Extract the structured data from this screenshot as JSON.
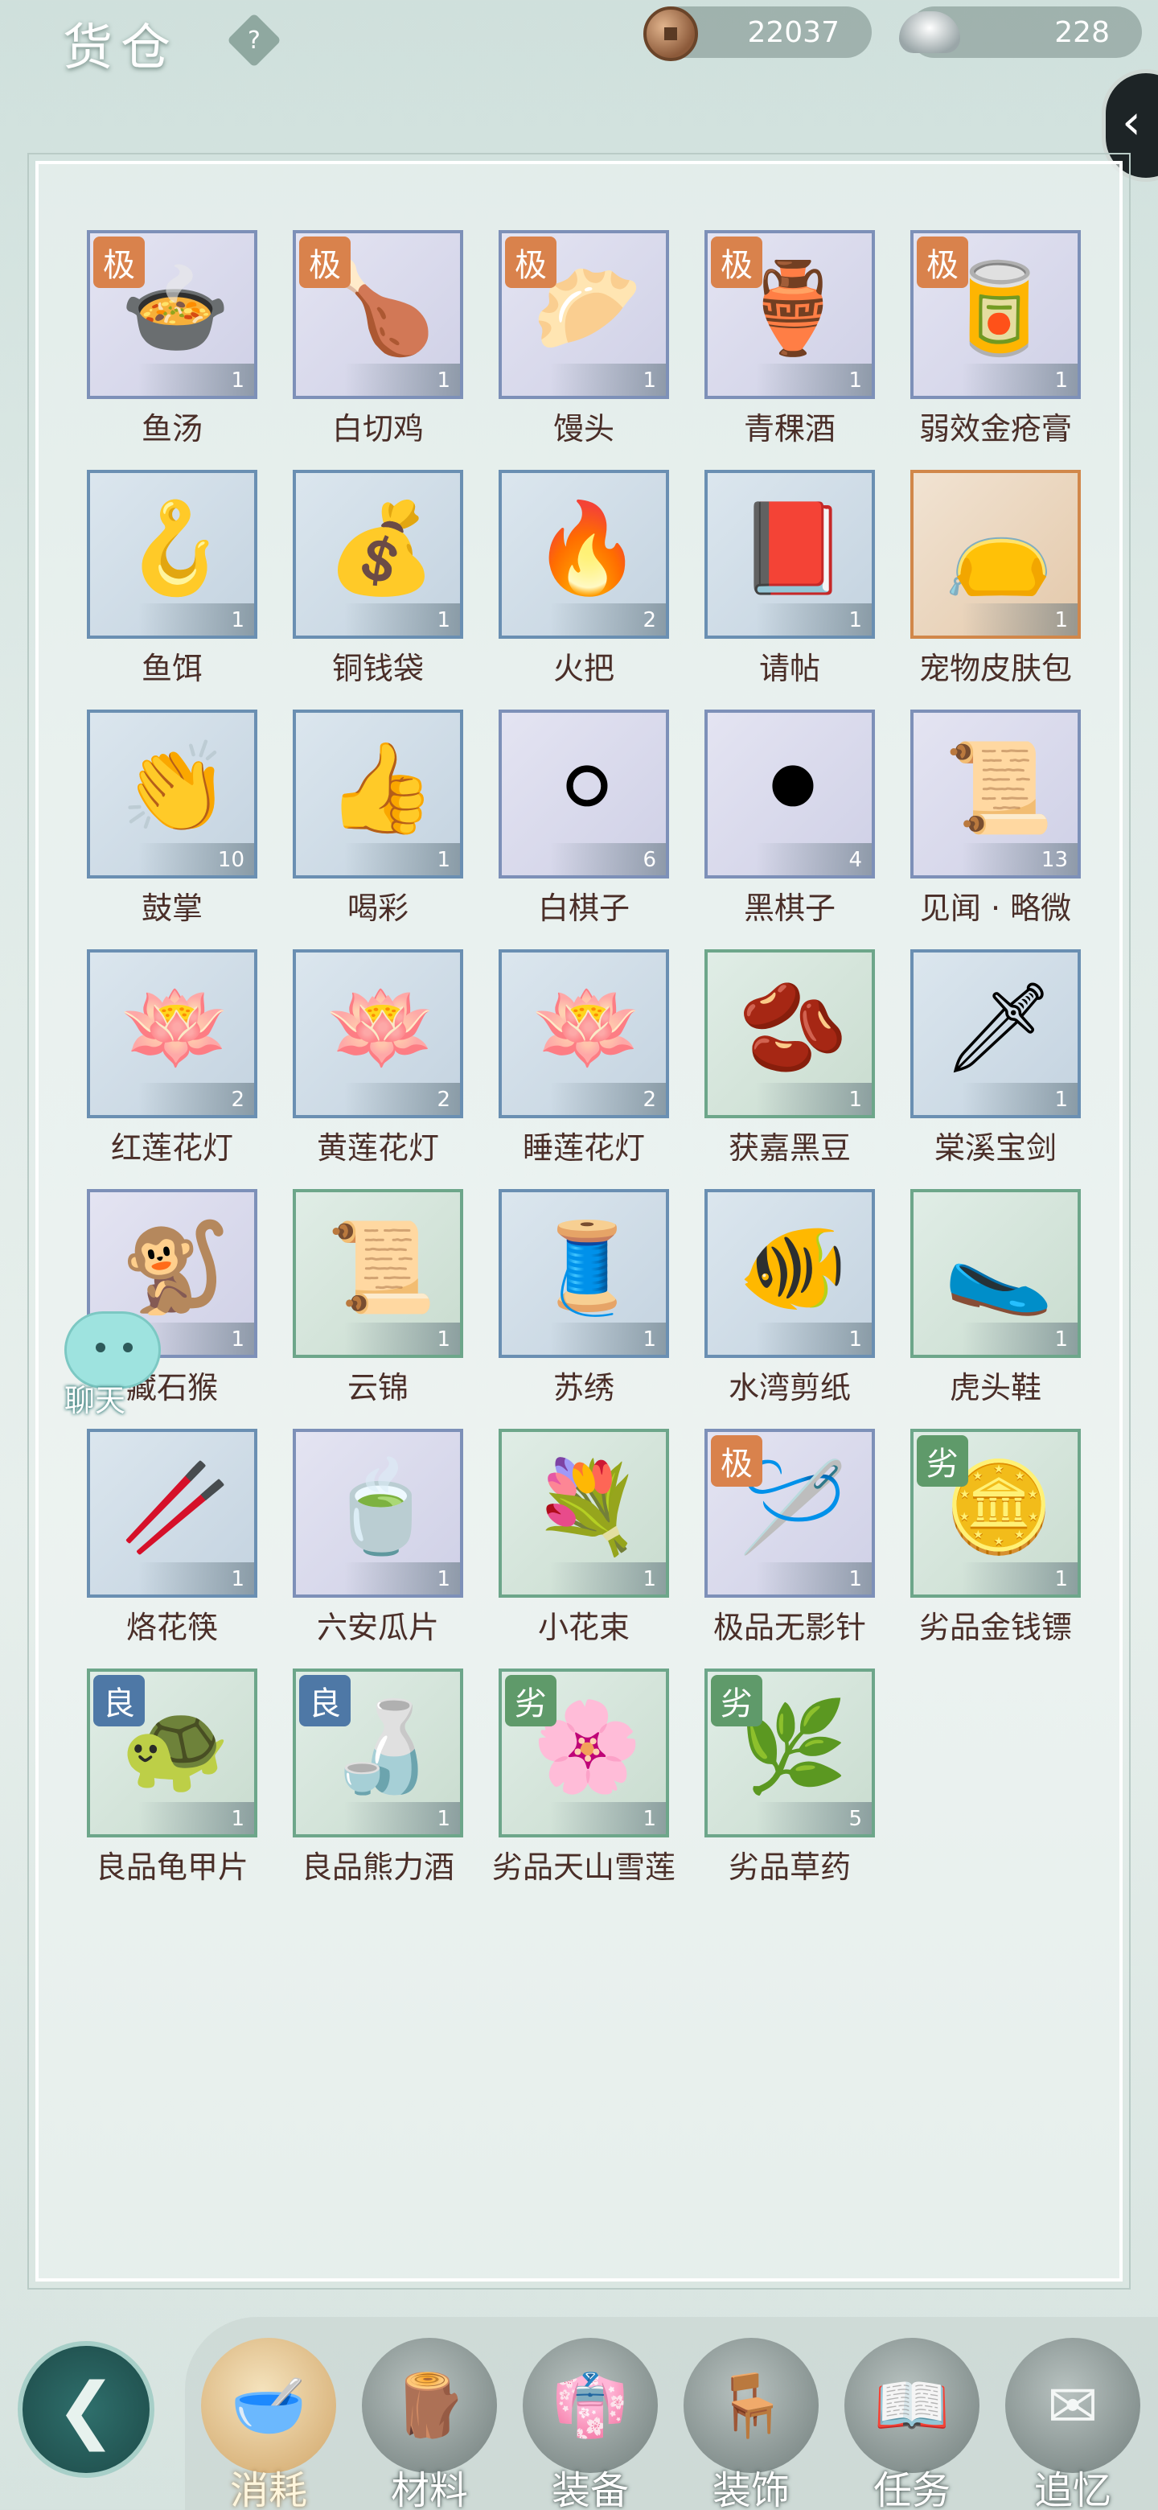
{
  "header": {
    "title": "货仓",
    "help": "?",
    "copper": "22037",
    "silver": "228"
  },
  "chat": {
    "label": "聊天"
  },
  "items": [
    {
      "name": "鱼汤",
      "count": "1",
      "badge": "极",
      "icon": "🍲",
      "frame": "purple"
    },
    {
      "name": "白切鸡",
      "count": "1",
      "badge": "极",
      "icon": "🍗",
      "frame": "purple"
    },
    {
      "name": "馒头",
      "count": "1",
      "badge": "极",
      "icon": "🥟",
      "frame": "purple"
    },
    {
      "name": "青稞酒",
      "count": "1",
      "badge": "极",
      "icon": "🏺",
      "frame": "purple"
    },
    {
      "name": "弱效金疮膏",
      "count": "1",
      "badge": "极",
      "icon": "🥫",
      "frame": "purple"
    },
    {
      "name": "鱼饵",
      "count": "1",
      "badge": "",
      "icon": "🪝",
      "frame": "blue"
    },
    {
      "name": "铜钱袋",
      "count": "1",
      "badge": "",
      "icon": "💰",
      "frame": "blue"
    },
    {
      "name": "火把",
      "count": "2",
      "badge": "",
      "icon": "🔥",
      "frame": "blue"
    },
    {
      "name": "请帖",
      "count": "1",
      "badge": "",
      "icon": "📕",
      "frame": "blue"
    },
    {
      "name": "宠物皮肤包",
      "count": "1",
      "badge": "",
      "icon": "👝",
      "frame": "orange"
    },
    {
      "name": "鼓掌",
      "count": "10",
      "badge": "",
      "icon": "👏",
      "frame": "blue"
    },
    {
      "name": "喝彩",
      "count": "1",
      "badge": "",
      "icon": "👍",
      "frame": "blue"
    },
    {
      "name": "白棋子",
      "count": "6",
      "badge": "",
      "icon": "⚪",
      "frame": "purple"
    },
    {
      "name": "黑棋子",
      "count": "4",
      "badge": "",
      "icon": "⚫",
      "frame": "purple"
    },
    {
      "name": "见闻 · 略微",
      "count": "13",
      "badge": "",
      "icon": "📜",
      "frame": "purple"
    },
    {
      "name": "红莲花灯",
      "count": "2",
      "badge": "",
      "icon": "🪷",
      "frame": "blue"
    },
    {
      "name": "黄莲花灯",
      "count": "2",
      "badge": "",
      "icon": "🪷",
      "frame": "blue"
    },
    {
      "name": "睡莲花灯",
      "count": "2",
      "badge": "",
      "icon": "🪷",
      "frame": "blue"
    },
    {
      "name": "获嘉黑豆",
      "count": "1",
      "badge": "",
      "icon": "🫘",
      "frame": "green"
    },
    {
      "name": "棠溪宝剑",
      "count": "1",
      "badge": "",
      "icon": "🗡",
      "frame": "blue"
    },
    {
      "name": "藏石猴",
      "count": "1",
      "badge": "",
      "icon": "🐒",
      "frame": "purple"
    },
    {
      "name": "云锦",
      "count": "1",
      "badge": "",
      "icon": "📜",
      "frame": "green"
    },
    {
      "name": "苏绣",
      "count": "1",
      "badge": "",
      "icon": "🧵",
      "frame": "blue"
    },
    {
      "name": "水湾剪纸",
      "count": "1",
      "badge": "",
      "icon": "🐠",
      "frame": "blue"
    },
    {
      "name": "虎头鞋",
      "count": "1",
      "badge": "",
      "icon": "🥿",
      "frame": "green"
    },
    {
      "name": "烙花筷",
      "count": "1",
      "badge": "",
      "icon": "🥢",
      "frame": "blue"
    },
    {
      "name": "六安瓜片",
      "count": "1",
      "badge": "",
      "icon": "🍵",
      "frame": "purple"
    },
    {
      "name": "小花束",
      "count": "1",
      "badge": "",
      "icon": "💐",
      "frame": "green"
    },
    {
      "name": "极品无影针",
      "count": "1",
      "badge": "极",
      "icon": "🪡",
      "frame": "purple"
    },
    {
      "name": "劣品金钱镖",
      "count": "1",
      "badge": "劣",
      "icon": "🪙",
      "frame": "green"
    },
    {
      "name": "良品龟甲片",
      "count": "1",
      "badge": "良",
      "icon": "🐢",
      "frame": "green"
    },
    {
      "name": "良品熊力酒",
      "count": "1",
      "badge": "良",
      "icon": "🍶",
      "frame": "green"
    },
    {
      "name": "劣品天山雪莲",
      "count": "1",
      "badge": "劣",
      "icon": "🌸",
      "frame": "green"
    },
    {
      "name": "劣品草药",
      "count": "5",
      "badge": "劣",
      "icon": "🌿",
      "frame": "green"
    }
  ],
  "tabs": [
    {
      "label": "消耗",
      "icon": "🥣",
      "active": true
    },
    {
      "label": "材料",
      "icon": "🪵",
      "active": false
    },
    {
      "label": "装备",
      "icon": "👘",
      "active": false
    },
    {
      "label": "装饰",
      "icon": "🪑",
      "active": false
    },
    {
      "label": "任务",
      "icon": "📖",
      "active": false
    },
    {
      "label": "追忆",
      "icon": "✉",
      "active": false
    }
  ],
  "colors": {
    "badge_ji": "#d9824c",
    "badge_liang": "#4e78a6",
    "badge_lie": "#5f9a6a",
    "text_label": "#4a2e28"
  }
}
